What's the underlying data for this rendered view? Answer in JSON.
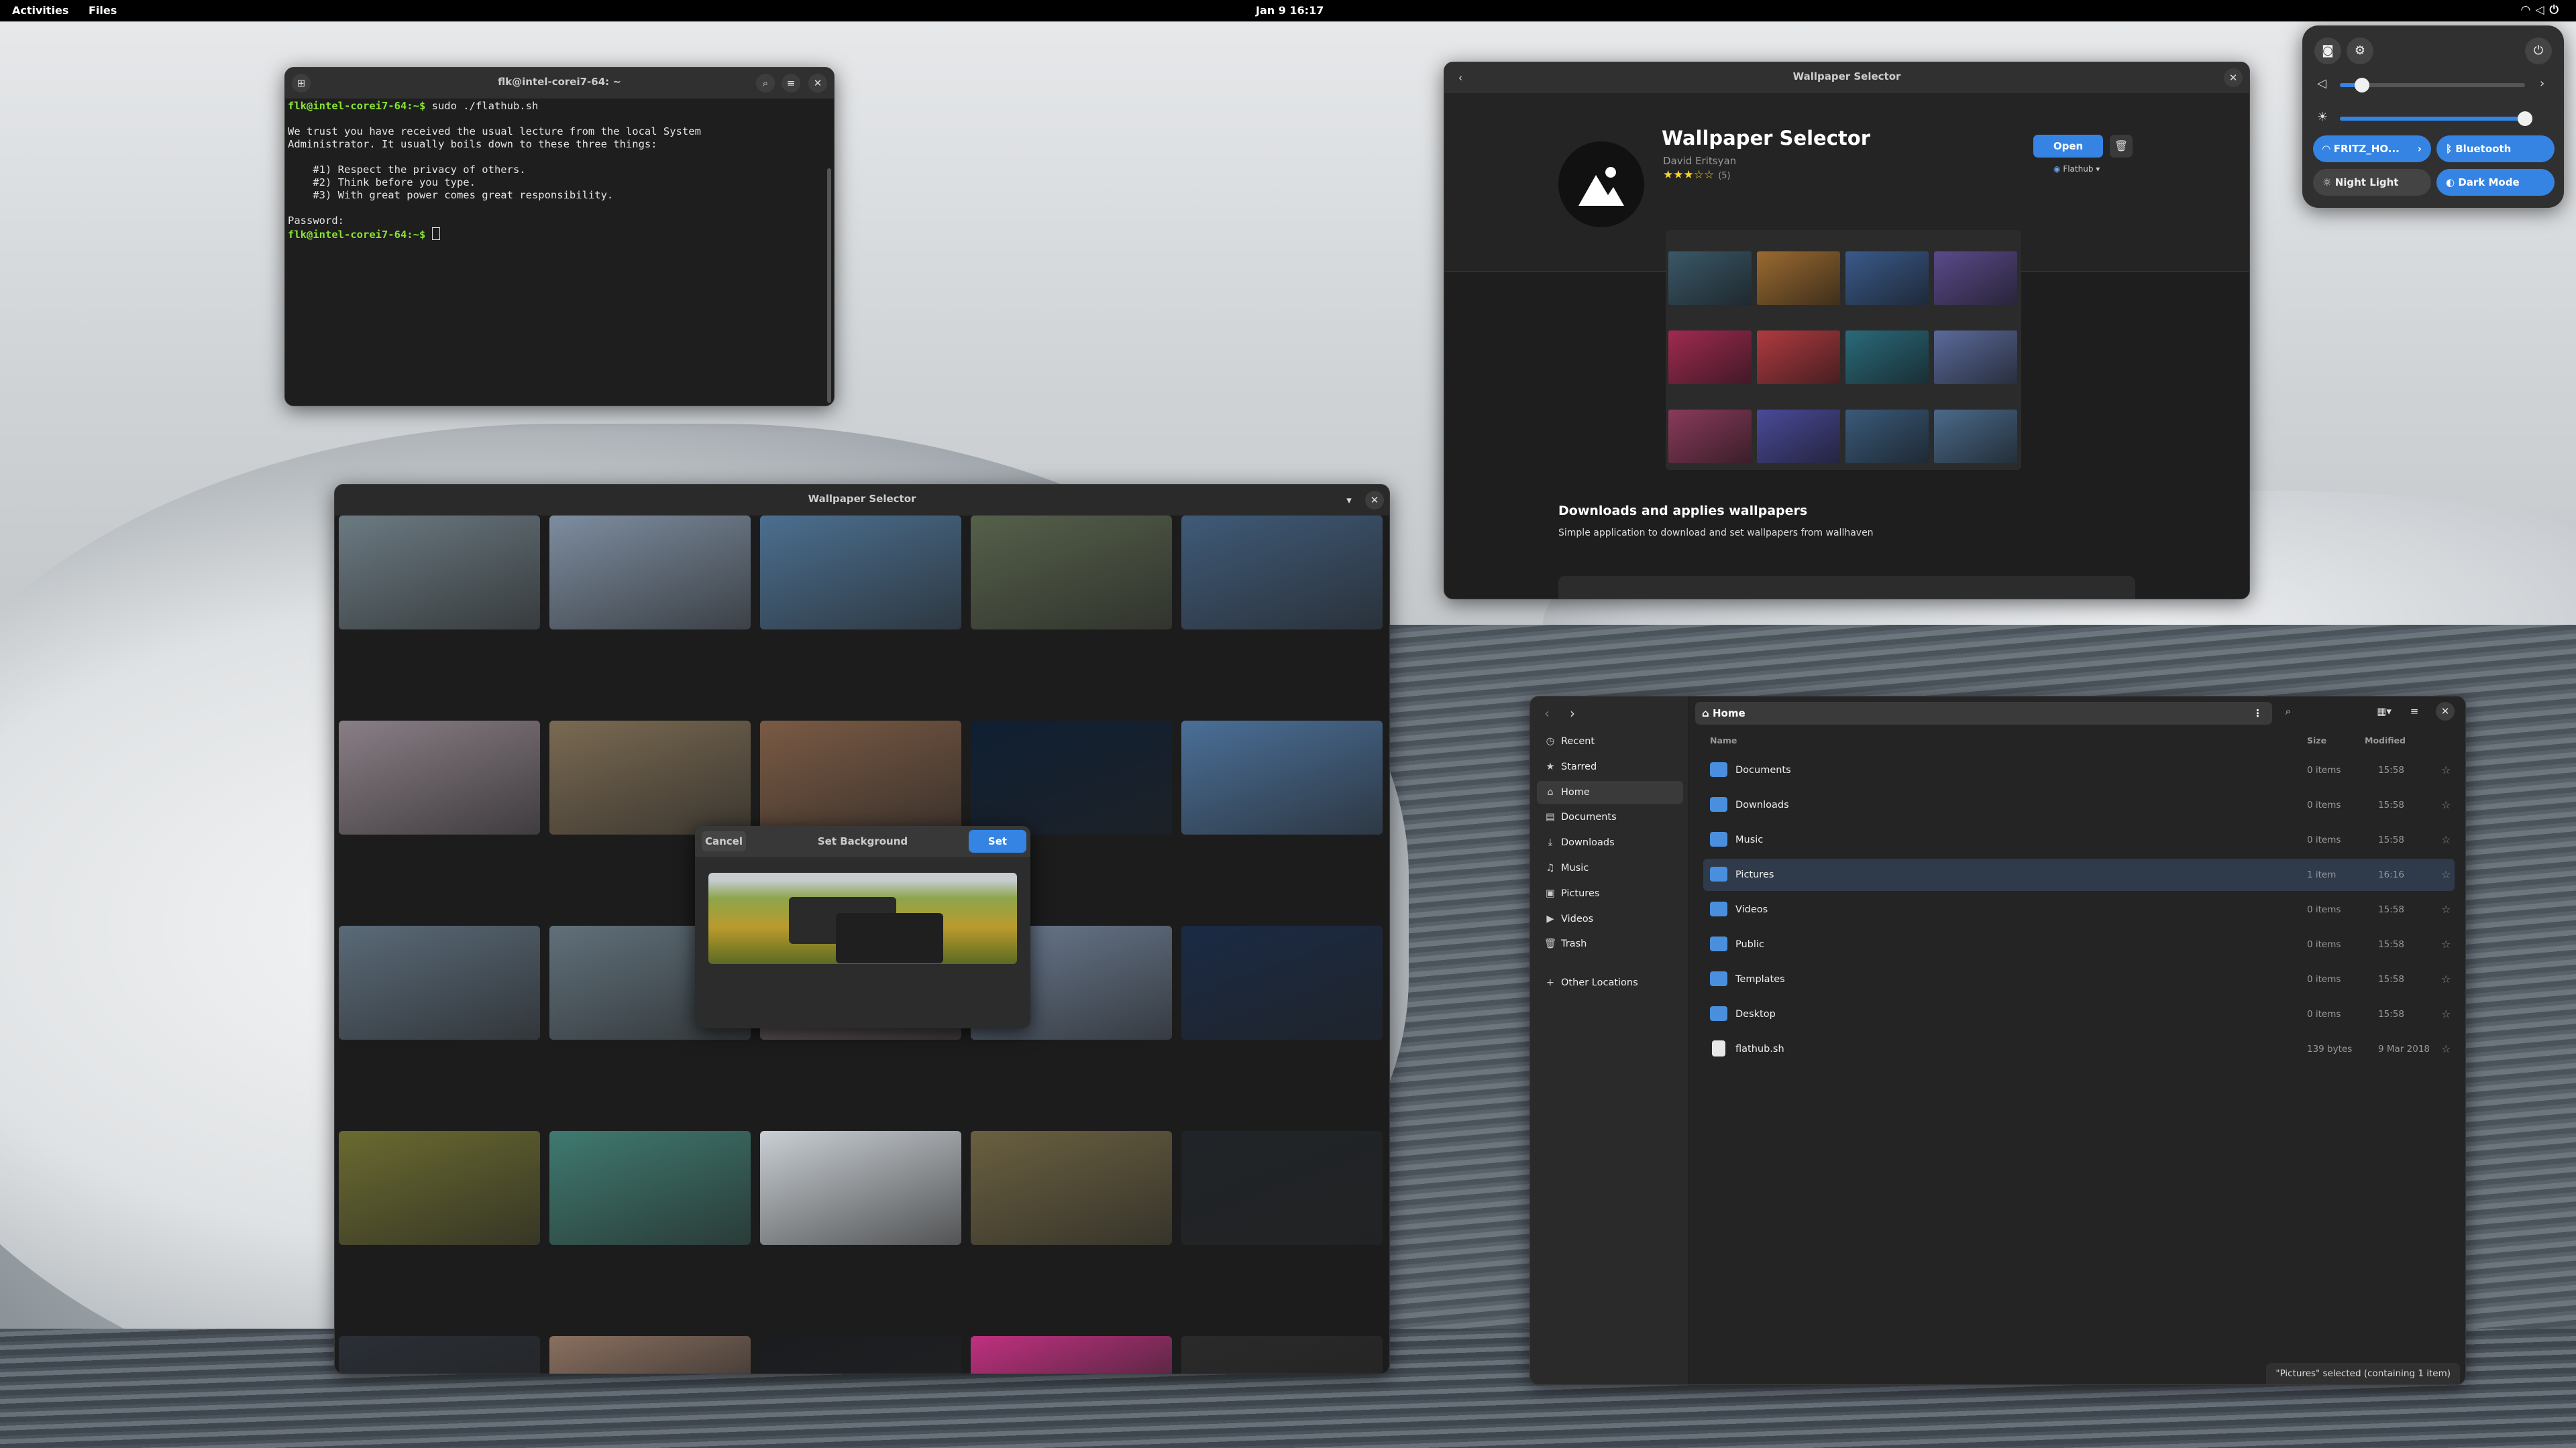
{
  "topbar": {
    "activities": "Activities",
    "app": "Files",
    "clock": "Jan 9  16:17"
  },
  "terminal": {
    "title": "flk@intel-corei7-64: ~",
    "lines": [
      {
        "prompt": "flk@intel-corei7-64:~$",
        "text": " sudo ./flathub.sh"
      },
      {
        "prompt": "",
        "text": ""
      },
      {
        "prompt": "",
        "text": "We trust you have received the usual lecture from the local System"
      },
      {
        "prompt": "",
        "text": "Administrator. It usually boils down to these three things:"
      },
      {
        "prompt": "",
        "text": ""
      },
      {
        "prompt": "",
        "text": "    #1) Respect the privacy of others."
      },
      {
        "prompt": "",
        "text": "    #2) Think before you type."
      },
      {
        "prompt": "",
        "text": "    #3) With great power comes great responsibility."
      },
      {
        "prompt": "",
        "text": ""
      },
      {
        "prompt": "",
        "text": "Password:"
      },
      {
        "prompt": "flk@intel-corei7-64:~$",
        "text": " "
      }
    ]
  },
  "selector": {
    "title": "Wallpaper Selector",
    "dialog": {
      "cancel": "Cancel",
      "title": "Set Background",
      "set": "Set"
    },
    "thumb_colors": [
      [
        "#6b7a82",
        "#7d8da0",
        "#4b6f90",
        "#55604a",
        "#3f5a78"
      ],
      [
        "#8a7e86",
        "#7a6a52",
        "#7a5a44",
        "#0f1f33",
        "#4a6f98"
      ],
      [
        "#5a6a78",
        "#60707a",
        "#7a6a70",
        "#6a7a90",
        "#1a2a44"
      ],
      [
        "#6a6a30",
        "#3f7a70",
        "#c9cfd4",
        "#6a6040",
        "#202428"
      ],
      [
        "#2a2f36",
        "#8a7060",
        "#1a1c20",
        "#c03080",
        "#2a2a2a"
      ]
    ]
  },
  "software": {
    "title": "Wallpaper Selector",
    "name": "Wallpaper Selector",
    "developer": "David Eritsyan",
    "stars": "★★★☆☆",
    "rating_count": "(5)",
    "open": "Open",
    "source": "Flathub",
    "tagline": "Downloads and applies wallpapers",
    "description": "Simple application to download and set wallpapers from wallhaven",
    "shot_colors": [
      "#3a5868",
      "#9a6a30",
      "#3a5a8a",
      "#5a4a8a",
      "#a02a50",
      "#b03a40",
      "#2a6a7a",
      "#5a6a9a",
      "#8a3a5a",
      "#4a4a9a",
      "#3a5a7a",
      "#4a6a8a"
    ]
  },
  "files": {
    "path": "Home",
    "sidebar": [
      "Recent",
      "Starred",
      "Home",
      "Documents",
      "Downloads",
      "Music",
      "Pictures",
      "Videos",
      "Trash",
      "Other Locations"
    ],
    "sidebar_icons": [
      "◷",
      "★",
      "⌂",
      "▤",
      "⤓",
      "♫",
      "▣",
      "▶",
      "🗑",
      "+"
    ],
    "columns": {
      "name": "Name",
      "size": "Size",
      "modified": "Modified"
    },
    "rows": [
      {
        "name": "Documents",
        "size": "0 items",
        "modified": "15:58"
      },
      {
        "name": "Downloads",
        "size": "0 items",
        "modified": "15:58"
      },
      {
        "name": "Music",
        "size": "0 items",
        "modified": "15:58"
      },
      {
        "name": "Pictures",
        "size": "1 item",
        "modified": "16:16"
      },
      {
        "name": "Videos",
        "size": "0 items",
        "modified": "15:58"
      },
      {
        "name": "Public",
        "size": "0 items",
        "modified": "15:58"
      },
      {
        "name": "Templates",
        "size": "0 items",
        "modified": "15:58"
      },
      {
        "name": "Desktop",
        "size": "0 items",
        "modified": "15:58"
      },
      {
        "name": "flathub.sh",
        "size": "139 bytes",
        "modified": "9 Mar 2018"
      }
    ],
    "status": "\"Pictures\" selected (containing 1 item)"
  },
  "quick": {
    "wifi": "FRITZ_HO...",
    "bluetooth": "Bluetooth",
    "night": "Night Light",
    "dark": "Dark Mode",
    "volume": 0.12,
    "brightness": 1.0
  }
}
